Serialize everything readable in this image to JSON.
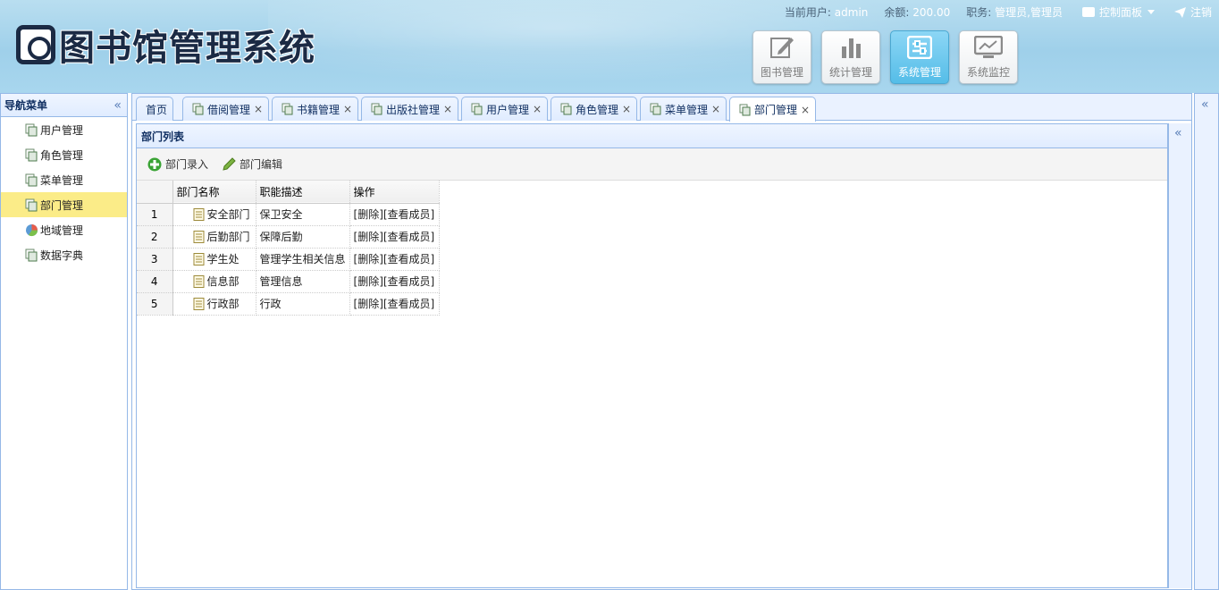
{
  "header": {
    "logo_text": "图书馆管理系统",
    "current_user_label": "当前用户:",
    "current_user": "admin",
    "balance_label": "余额:",
    "balance": "200.00",
    "role_label": "职务:",
    "role": "管理员,管理员",
    "control_panel": "控制面板",
    "logout": "注销",
    "modules": [
      {
        "label": "图书管理",
        "icon": "edit-icon"
      },
      {
        "label": "统计管理",
        "icon": "bar-chart-icon"
      },
      {
        "label": "系统管理",
        "icon": "sliders-icon"
      },
      {
        "label": "系统监控",
        "icon": "monitor-icon"
      }
    ]
  },
  "sidebar": {
    "title": "导航菜单",
    "items": [
      {
        "label": "用户管理"
      },
      {
        "label": "角色管理"
      },
      {
        "label": "菜单管理"
      },
      {
        "label": "部门管理"
      },
      {
        "label": "地域管理"
      },
      {
        "label": "数据字典"
      }
    ]
  },
  "tabs": [
    {
      "label": "首页"
    },
    {
      "label": "借阅管理"
    },
    {
      "label": "书籍管理"
    },
    {
      "label": "出版社管理"
    },
    {
      "label": "用户管理"
    },
    {
      "label": "角色管理"
    },
    {
      "label": "菜单管理"
    },
    {
      "label": "部门管理"
    }
  ],
  "panel": {
    "title": "部门列表",
    "add_label": "部门录入",
    "edit_label": "部门编辑"
  },
  "grid": {
    "columns": [
      "部门名称",
      "职能描述",
      "操作"
    ],
    "rows": [
      {
        "num": "1",
        "name": "安全部门",
        "desc": "保卫安全",
        "action": "[删除][查看成员]"
      },
      {
        "num": "2",
        "name": "后勤部门",
        "desc": "保障后勤",
        "action": "[删除][查看成员]"
      },
      {
        "num": "3",
        "name": "学生处",
        "desc": "管理学生相关信息",
        "action": "[删除][查看成员]"
      },
      {
        "num": "4",
        "name": "信息部",
        "desc": "管理信息",
        "action": "[删除][查看成员]"
      },
      {
        "num": "5",
        "name": "行政部",
        "desc": "行政",
        "action": "[删除][查看成员]"
      }
    ]
  }
}
